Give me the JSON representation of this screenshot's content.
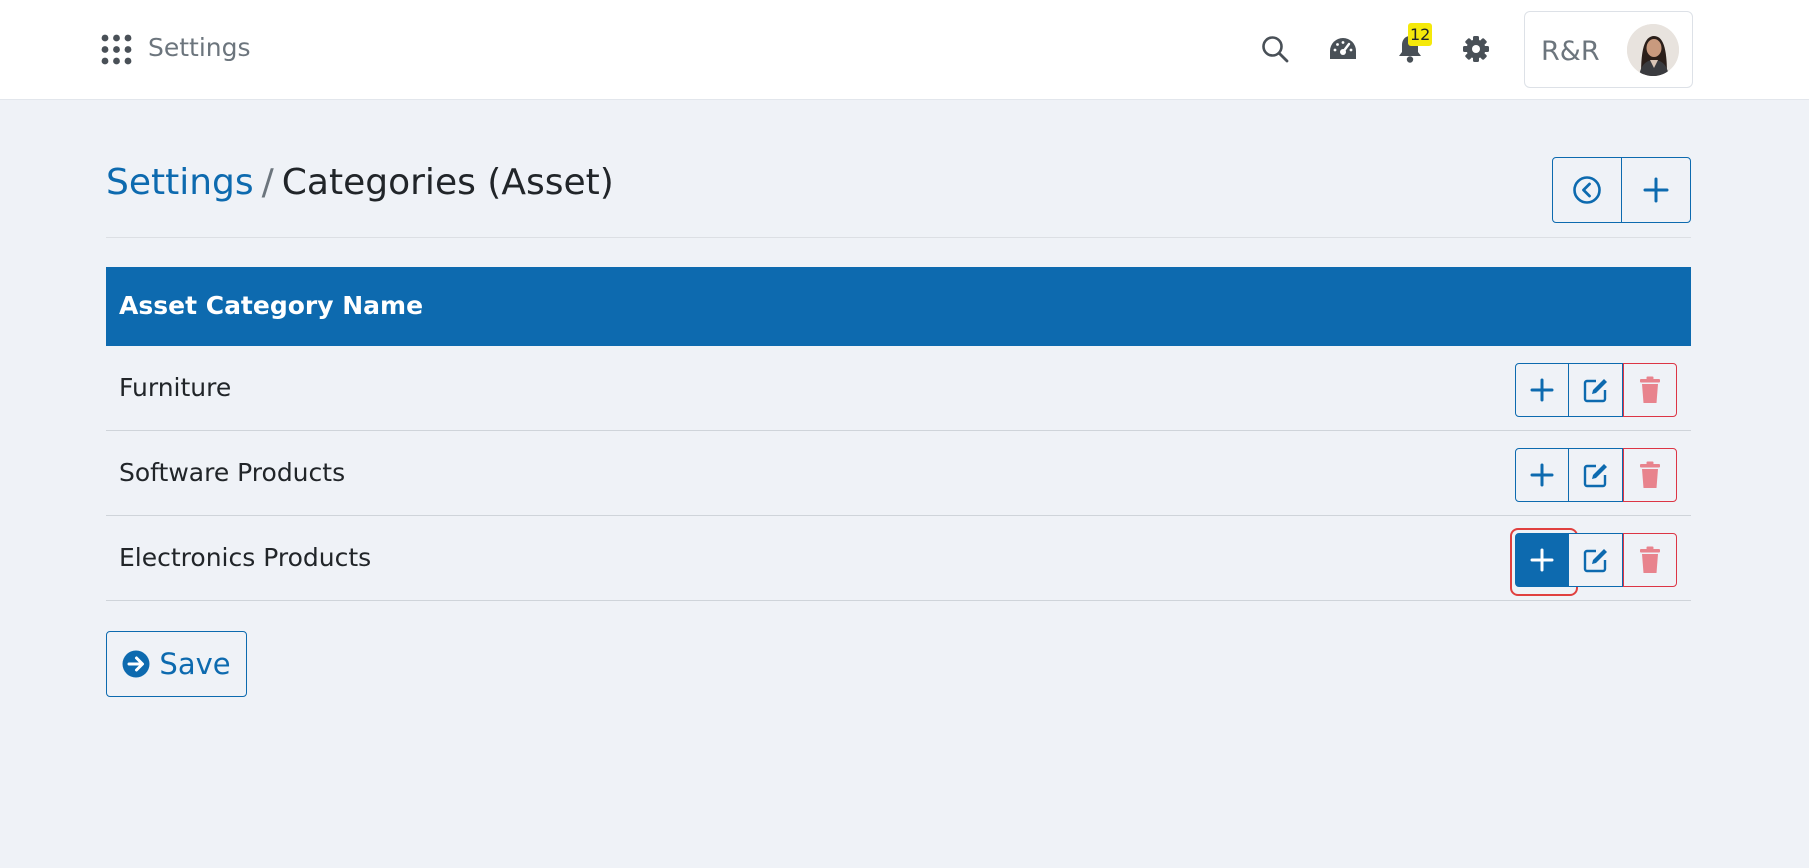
{
  "app": {
    "title": "Settings"
  },
  "topbar": {
    "notifications_count": "12",
    "user_name": "R&R",
    "icons": [
      "apps-grid-icon",
      "search-icon",
      "dashboard-gauge-icon",
      "bell-icon",
      "gear-icon"
    ]
  },
  "breadcrumb": {
    "parent": "Settings",
    "separator": "/",
    "current": "Categories (Asset)"
  },
  "table": {
    "header": "Asset Category Name",
    "rows": [
      {
        "name": "Furniture"
      },
      {
        "name": "Software Products"
      },
      {
        "name": "Electronics Products"
      }
    ]
  },
  "save": {
    "label": "Save"
  },
  "colors": {
    "primary": "#0d6aaf",
    "danger": "#dc3545",
    "badge": "#f5e90a",
    "background": "#eff2f7",
    "highlight": "#e0403f"
  }
}
